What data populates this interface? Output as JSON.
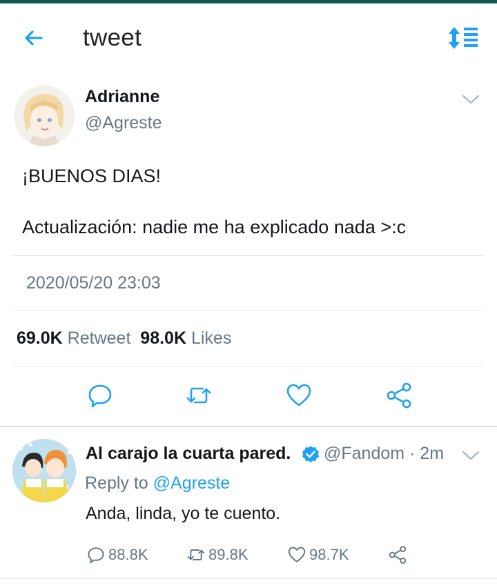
{
  "colors": {
    "accent": "#1da1f2",
    "muted": "#657786",
    "text": "#14171a",
    "status_bar": "#0e5a4e"
  },
  "header": {
    "title": "tweet",
    "back_icon": "arrow-left-icon",
    "sort_icon": "sort-icon"
  },
  "tweet": {
    "name": "Adrianne",
    "handle": "@Agreste",
    "lines": [
      "¡BUENOS DIAS!",
      "Actualización: nadie me ha explicado nada >:c"
    ],
    "timestamp": "2020/05/20 23:03",
    "retweets": "69.0K",
    "retweet_label": "Retweet",
    "likes": "98.0K",
    "likes_label": "Likes",
    "actions": [
      "reply-icon",
      "retweet-icon",
      "like-icon",
      "share-icon"
    ]
  },
  "reply": {
    "name": "Al carajo la cuarta pared.",
    "verified": true,
    "meta": "@Fandom · 2m",
    "reply_to_prefix": "Reply to",
    "reply_to_handle": "@Agreste",
    "text": "Anda, linda, yo te cuento.",
    "replies": "88.8K",
    "retweets": "89.8K",
    "likes": "98.7K"
  }
}
